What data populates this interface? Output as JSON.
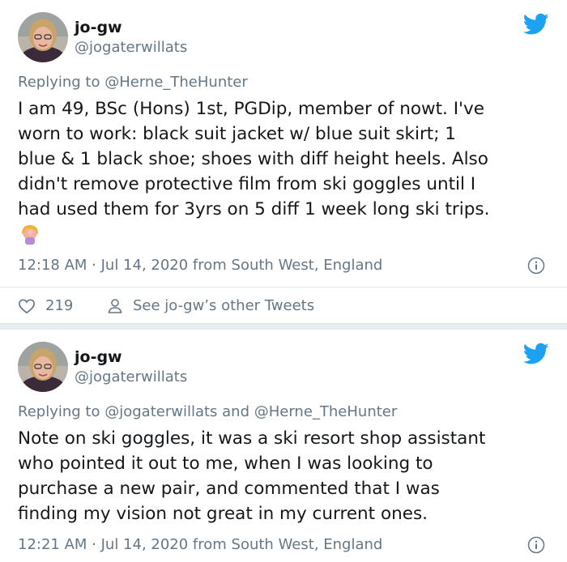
{
  "colors": {
    "text": "#14171a",
    "secondary": "#657786",
    "brand": "#1da1f2",
    "like": "#e0245e"
  },
  "tweets": [
    {
      "name": "jo-gw",
      "handle": "@jogaterwillats",
      "reply_prefix": "Replying to",
      "reply_to": "@Herne_TheHunter",
      "body_lines": [
        "I am 49, BSc (Hons) 1st, PGDip, member of nowt. I've",
        "worn to work: black suit jacket w/ blue suit skirt; 1",
        "blue & 1 black shoe; shoes with diff height heels. Also",
        "didn't remove protective film from ski goggles until I",
        "had used them for 3yrs on 5 diff 1 week long ski trips."
      ],
      "emoji": "woman-facepalming-emoji",
      "meta": "12:18 AM · Jul 14, 2020 from South West, England",
      "likes": "219",
      "see_other": "See jo-gw’s other Tweets"
    },
    {
      "name": "jo-gw",
      "handle": "@jogaterwillats",
      "reply_prefix": "Replying to",
      "reply_to": "@jogaterwillats and @Herne_TheHunter",
      "body_lines": [
        "Note on ski goggles, it was a ski resort shop assistant",
        "who pointed it out to me, when I was looking to",
        "purchase a new pair, and commented that I was",
        "finding my vision not great in my current ones."
      ],
      "meta": "12:21 AM · Jul 14, 2020 from South West, England"
    }
  ]
}
